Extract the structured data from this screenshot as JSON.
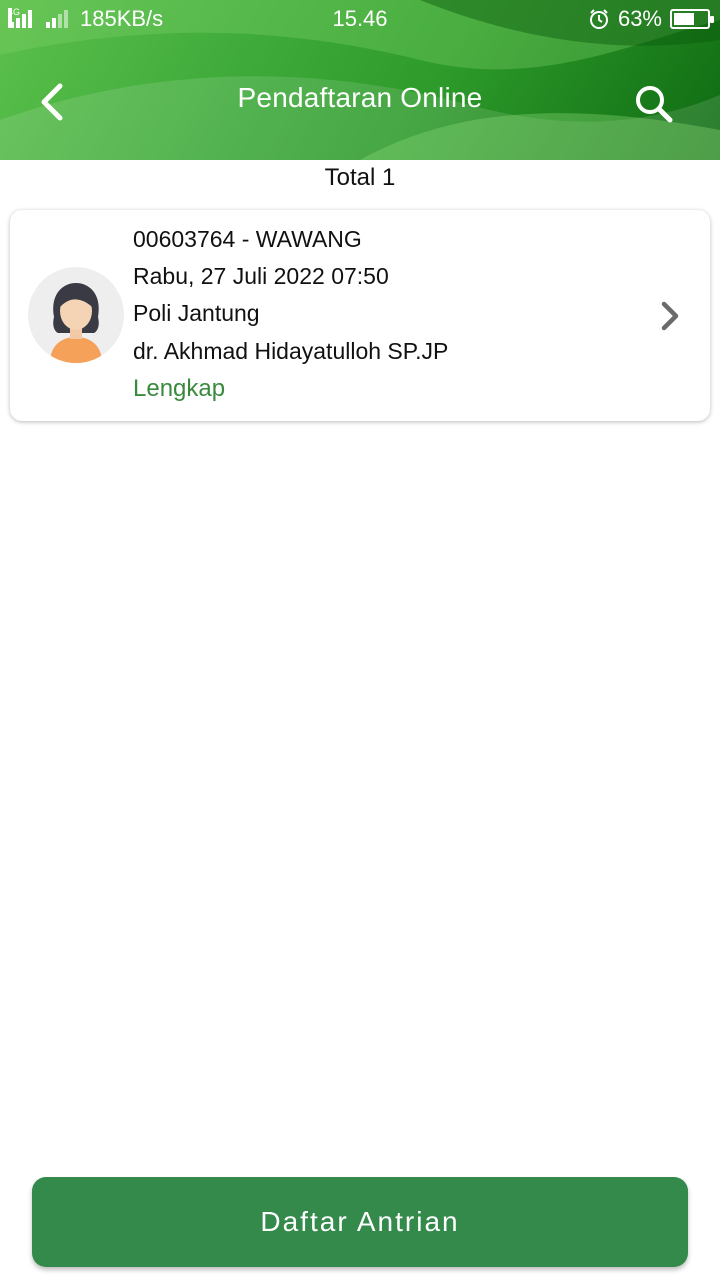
{
  "status_bar": {
    "network_type": "4G",
    "speed": "185KB/s",
    "time": "15.46",
    "battery_percent": "63%",
    "battery_level": 0.63,
    "icons": [
      "signal-icon",
      "signal-icon-2",
      "alarm-icon",
      "battery-icon"
    ]
  },
  "header": {
    "title": "Pendaftaran Online",
    "back_icon": "chevron-left-icon",
    "search_icon": "search-icon",
    "colors": {
      "light": "#5cc04c",
      "mid": "#2d9a2a",
      "dark": "#0f6b12"
    }
  },
  "list": {
    "total_label": "Total 1",
    "items": [
      {
        "id_name": "00603764 - WAWANG",
        "datetime": "Rabu, 27 Juli 2022 07:50",
        "poli": "Poli Jantung",
        "doctor": "dr. Akhmad Hidayatulloh SP.JP",
        "status": "Lengkap",
        "status_color": "#3a8a3e",
        "avatar_icon": "female-user-avatar-icon",
        "chevron_icon": "chevron-right-icon"
      }
    ]
  },
  "footer": {
    "button_label": "Daftar Antrian",
    "button_color": "#348a4b"
  }
}
